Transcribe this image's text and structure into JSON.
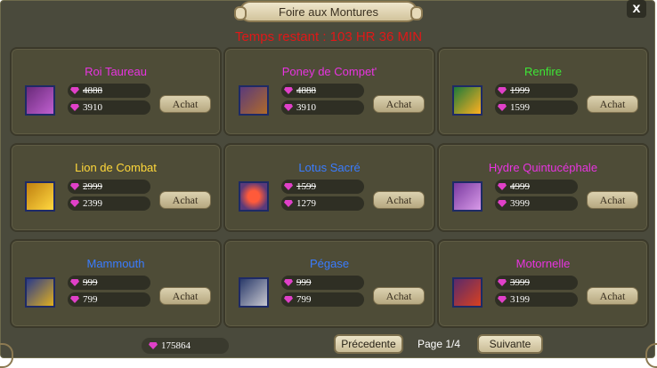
{
  "window": {
    "title": "Foire aux Montures",
    "close_label": "x",
    "timer": "Temps restant : 103 HR 36 MIN"
  },
  "colors": {
    "pink": "#e834e0",
    "green": "#3ee636",
    "yellow": "#ffd83a",
    "blue": "#3a7cff",
    "red_timer": "#e01818"
  },
  "buy_label": "Achat",
  "mounts": [
    {
      "name": "Roi Taureau",
      "color": "#e834e0",
      "old_price": "4888",
      "price": "3910",
      "icon": "bull-mount-icon"
    },
    {
      "name": "Poney de Compet'",
      "color": "#e834e0",
      "old_price": "4888",
      "price": "3910",
      "icon": "pony-mount-icon"
    },
    {
      "name": "Renfire",
      "color": "#3ee636",
      "old_price": "1999",
      "price": "1599",
      "icon": "fire-mount-icon"
    },
    {
      "name": "Lion de Combat",
      "color": "#ffd83a",
      "old_price": "2999",
      "price": "2399",
      "icon": "lion-mount-icon"
    },
    {
      "name": "Lotus Sacré",
      "color": "#3a7cff",
      "old_price": "1599",
      "price": "1279",
      "icon": "lotus-mount-icon"
    },
    {
      "name": "Hydre Quintucéphale",
      "color": "#e834e0",
      "old_price": "4999",
      "price": "3999",
      "icon": "hydra-mount-icon"
    },
    {
      "name": "Mammouth",
      "color": "#3a7cff",
      "old_price": "999",
      "price": "799",
      "icon": "mammoth-mount-icon"
    },
    {
      "name": "Pégase",
      "color": "#3a7cff",
      "old_price": "999",
      "price": "799",
      "icon": "pegasus-mount-icon"
    },
    {
      "name": "Motornelle",
      "color": "#e834e0",
      "old_price": "3999",
      "price": "3199",
      "icon": "motorcycle-mount-icon"
    }
  ],
  "footer": {
    "balance": "175864",
    "prev_label": "Précedente",
    "page_label": "Page 1/4",
    "next_label": "Suivante"
  }
}
